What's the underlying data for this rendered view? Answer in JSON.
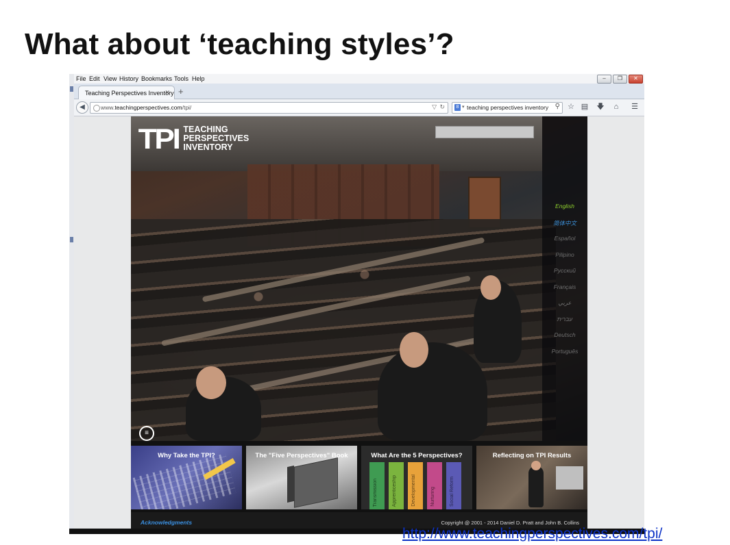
{
  "slide": {
    "title": "What about ‘teaching styles’?",
    "source_url": "http://www.teachingperspectives.com/tpi/"
  },
  "browser": {
    "menu": [
      "File",
      "Edit",
      "View",
      "History",
      "Bookmarks",
      "Tools",
      "Help"
    ],
    "window_buttons": {
      "minimize": "–",
      "restore": "❐",
      "close": "✕"
    },
    "tab": {
      "label": "Teaching Perspectives Inventory",
      "close": "✕"
    },
    "new_tab": "+",
    "url": {
      "prefix": "www.",
      "domain": "teachingperspectives.com",
      "path": "/tpi/"
    },
    "search": {
      "engine": "8",
      "query": "teaching perspectives inventory"
    },
    "toolbar_icons": [
      "star-icon",
      "clipboard-icon",
      "download-icon",
      "home-icon",
      "menu-icon"
    ]
  },
  "site": {
    "logo": {
      "mark": "TPI",
      "line1": "TEACHING",
      "line2": "PERSPECTIVES",
      "line3": "INVENTORY"
    },
    "languages": [
      {
        "label": "English",
        "state": "active"
      },
      {
        "label": "简体中文",
        "state": "hover"
      },
      {
        "label": "Español",
        "state": ""
      },
      {
        "label": "Pilipino",
        "state": ""
      },
      {
        "label": "Русский",
        "state": ""
      },
      {
        "label": "Français",
        "state": ""
      },
      {
        "label": "عربي",
        "state": ""
      },
      {
        "label": "עברית",
        "state": ""
      },
      {
        "label": "Deutsch",
        "state": ""
      },
      {
        "label": "Português",
        "state": ""
      }
    ],
    "tiles": [
      {
        "label": "Why Take the TPI?"
      },
      {
        "label": "The \"Five Perspectives\" Book"
      },
      {
        "label": "What Are the 5 Perspectives?"
      },
      {
        "label": "Reflecting on TPI Results"
      }
    ],
    "perspective_bars": [
      {
        "label": "Transmission",
        "color": "#3f9b52"
      },
      {
        "label": "Apprenticeship",
        "color": "#7bb43e"
      },
      {
        "label": "Developmental",
        "color": "#e8a23a"
      },
      {
        "label": "Nurturing",
        "color": "#c24a8a"
      },
      {
        "label": "Social Reform",
        "color": "#5b5ab5"
      }
    ],
    "footer": {
      "acknowledgments": "Acknowledgments",
      "copyright": "Copyright @ 2001 - 2014 Daniel D. Pratt and John B. Collins"
    }
  }
}
